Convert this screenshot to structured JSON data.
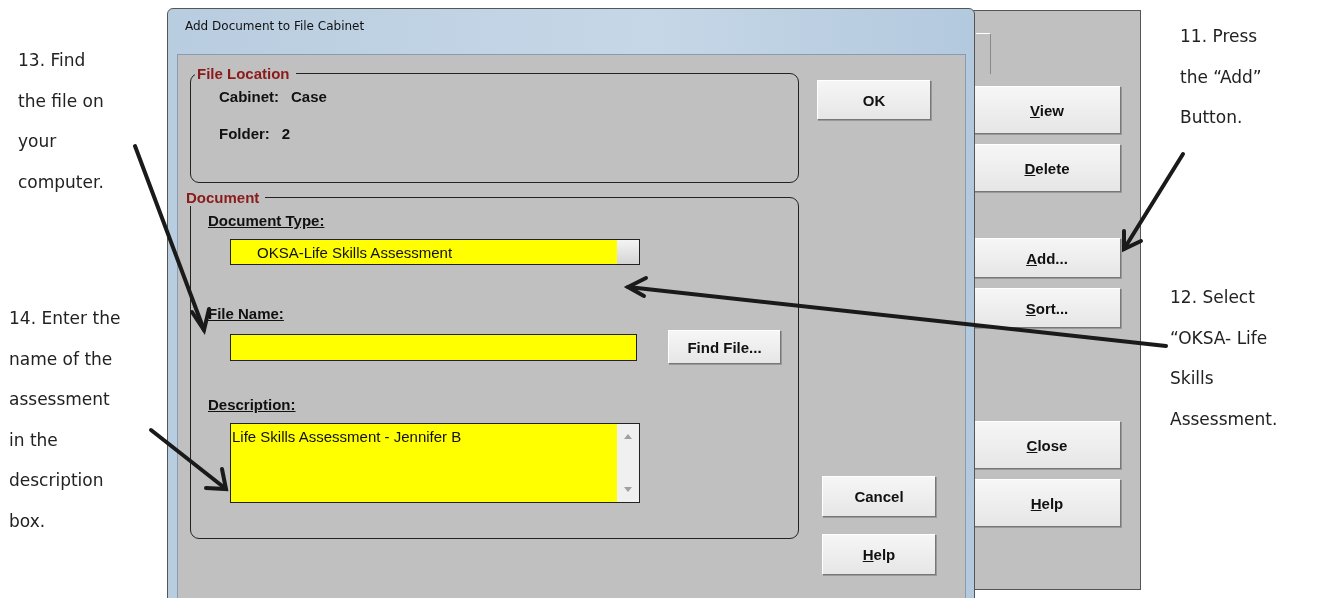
{
  "annotations": [
    {
      "lines": [
        "13.  Find",
        "the file on",
        "your",
        "computer."
      ]
    },
    {
      "lines": [
        "14.  Enter the",
        "name of the",
        "assessment",
        "in the",
        "description",
        "box."
      ]
    },
    {
      "lines": [
        "11.  Press",
        "the “Add”",
        "Button."
      ]
    },
    {
      "lines": [
        "12.  Select",
        "“OKSA- Life",
        "Skills",
        "Assessment."
      ]
    }
  ],
  "background_window": {
    "button_groups": [
      [
        {
          "label": "View",
          "mnemonic": true
        },
        {
          "label": "Delete",
          "mnemonic": true
        }
      ],
      [
        {
          "label": "Add...",
          "mnemonic": true
        },
        {
          "label": "Sort...",
          "mnemonic": true
        }
      ],
      [
        {
          "label": "Close",
          "mnemonic": true
        },
        {
          "label": "Help",
          "mnemonic": true
        }
      ]
    ]
  },
  "dialog": {
    "title": "Add Document to File Cabinet",
    "file_location": {
      "legend": "File Location",
      "rows": [
        {
          "label": "Cabinet:",
          "value": "Case"
        },
        {
          "label": "Folder:",
          "value": "2"
        }
      ]
    },
    "document": {
      "legend": "Document",
      "document_type": {
        "label": "Document Type:",
        "value": "OKSA-Life Skills Assessment"
      },
      "file_name": {
        "label": "File Name:"
      },
      "find_button": "Find File...",
      "description": {
        "label": "Description:",
        "value": "Life Skills Assessment - Jennifer B"
      }
    },
    "ok_button": {
      "label": "OK",
      "mnemonic": false
    },
    "bottom_buttons": [
      {
        "label": "Cancel",
        "mnemonic": false
      },
      {
        "label": "Help",
        "mnemonic": true
      }
    ]
  }
}
